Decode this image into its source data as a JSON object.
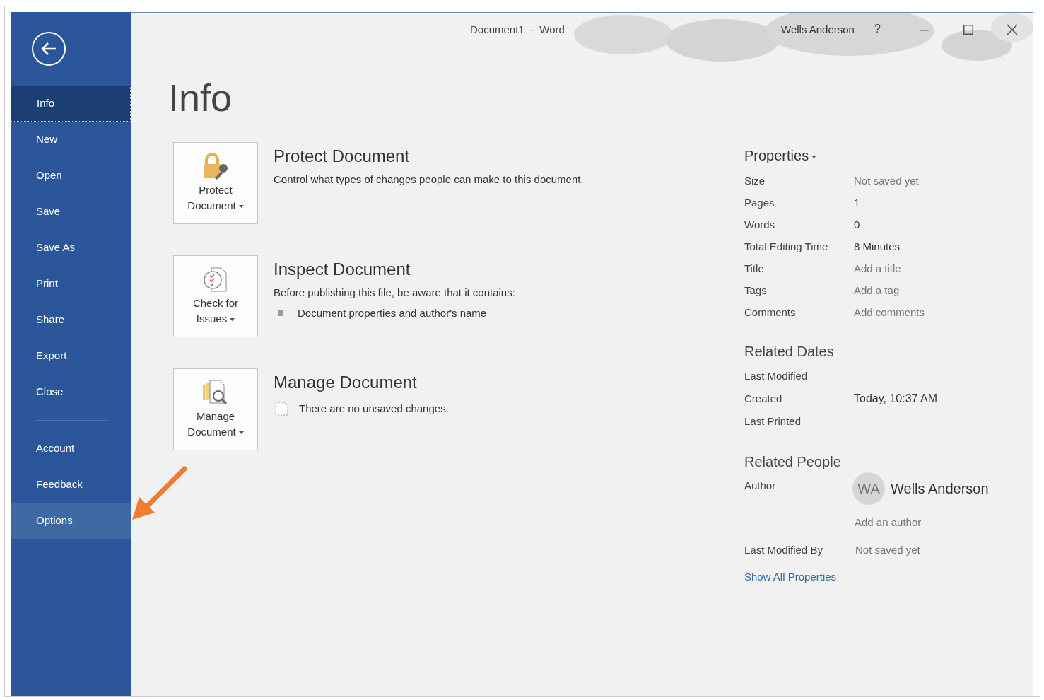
{
  "window": {
    "title": "Document1  -  Word",
    "user": "Wells Anderson",
    "help": "?"
  },
  "sidebar": {
    "main_items": [
      {
        "label": "Info",
        "selected": true,
        "hovered": false
      },
      {
        "label": "New",
        "selected": false,
        "hovered": false
      },
      {
        "label": "Open",
        "selected": false,
        "hovered": false
      },
      {
        "label": "Save",
        "selected": false,
        "hovered": false
      },
      {
        "label": "Save As",
        "selected": false,
        "hovered": false
      },
      {
        "label": "Print",
        "selected": false,
        "hovered": false
      },
      {
        "label": "Share",
        "selected": false,
        "hovered": false
      },
      {
        "label": "Export",
        "selected": false,
        "hovered": false
      },
      {
        "label": "Close",
        "selected": false,
        "hovered": false
      }
    ],
    "extra_items": [
      {
        "label": "Account",
        "selected": false,
        "hovered": false
      },
      {
        "label": "Feedback",
        "selected": false,
        "hovered": false
      },
      {
        "label": "Options",
        "selected": false,
        "hovered": true
      }
    ]
  },
  "page_title": "Info",
  "actions": [
    {
      "kind": "lock",
      "button_lines": [
        "Protect",
        "Document"
      ],
      "title": "Protect Document",
      "description": "Control what types of changes people can make to this document."
    },
    {
      "kind": "inspect",
      "button_lines": [
        "Check for",
        "Issues"
      ],
      "title": "Inspect Document",
      "description": "Before publishing this file, be aware that it contains:",
      "bullets": [
        "Document properties and author's name"
      ]
    },
    {
      "kind": "manage",
      "button_lines": [
        "Manage",
        "Document"
      ],
      "title": "Manage Document",
      "note": "There are no unsaved changes."
    }
  ],
  "properties": {
    "heading": "Properties",
    "rows": [
      {
        "label": "Size",
        "value": "Not saved yet",
        "muted": true
      },
      {
        "label": "Pages",
        "value": "1",
        "muted": false
      },
      {
        "label": "Words",
        "value": "0",
        "muted": false
      },
      {
        "label": "Total Editing Time",
        "value": "8 Minutes",
        "muted": false
      },
      {
        "label": "Title",
        "value": "Add a title",
        "muted": true
      },
      {
        "label": "Tags",
        "value": "Add a tag",
        "muted": true
      },
      {
        "label": "Comments",
        "value": "Add comments",
        "muted": true
      }
    ]
  },
  "related_dates": {
    "heading": "Related Dates",
    "rows": [
      {
        "label": "Last Modified"
      },
      {
        "label": "Created",
        "value": "Today, 10:37 AM"
      },
      {
        "label": "Last Printed"
      }
    ]
  },
  "related_people": {
    "heading": "Related People",
    "author_label": "Author",
    "author_initials": "WA",
    "author_name": "Wells Anderson",
    "add_author": "Add an author",
    "last_modified_by_label": "Last Modified By",
    "last_modified_by": "Not saved yet"
  },
  "show_all_link": "Show All Properties"
}
